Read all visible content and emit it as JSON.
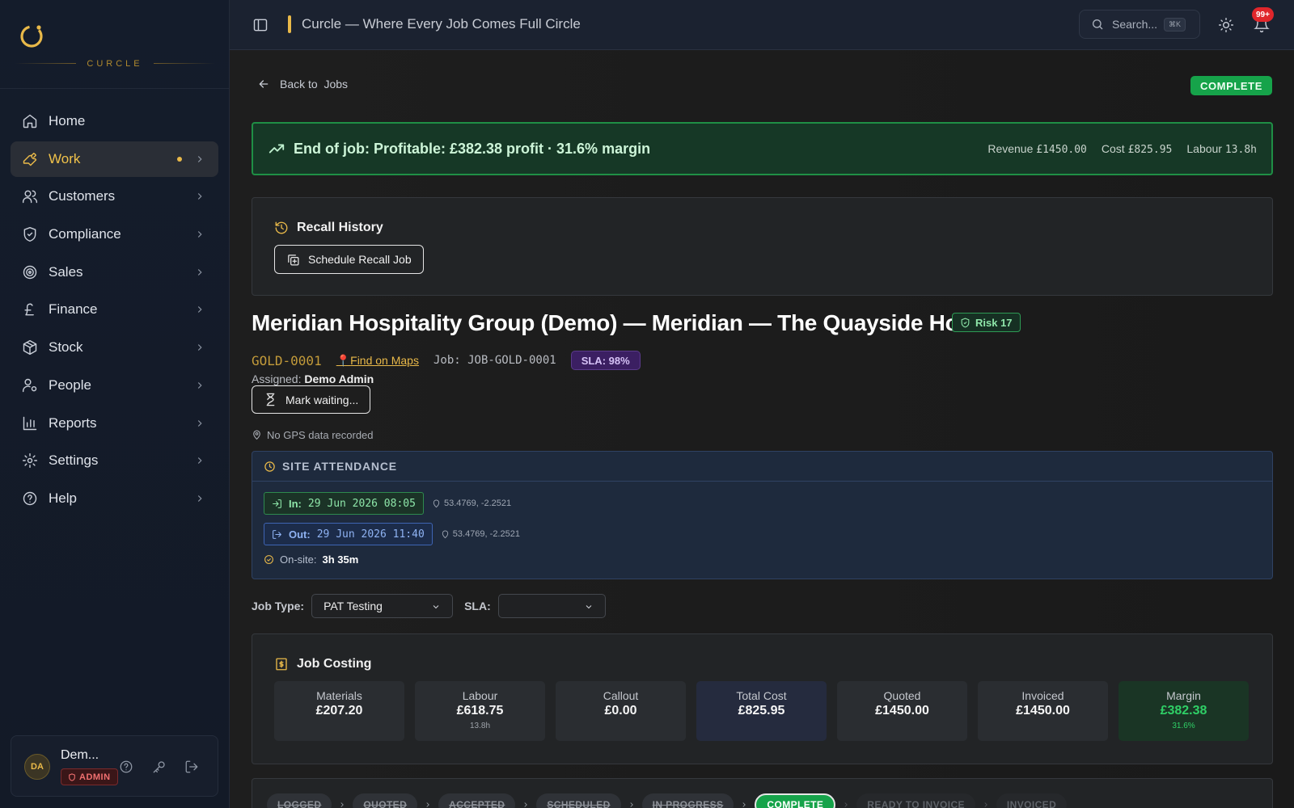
{
  "brand": {
    "name": "CURCLE"
  },
  "topbar": {
    "title": "Curcle — Where Every Job Comes Full Circle",
    "search_placeholder": "Search...",
    "search_shortcut": "⌘K",
    "notifications": "99+"
  },
  "sidebar": {
    "items": [
      {
        "label": "Home",
        "icon": "home-icon"
      },
      {
        "label": "Work",
        "icon": "wrench-icon",
        "active": true
      },
      {
        "label": "Customers",
        "icon": "users-icon"
      },
      {
        "label": "Compliance",
        "icon": "shield-icon"
      },
      {
        "label": "Sales",
        "icon": "target-icon"
      },
      {
        "label": "Finance",
        "icon": "pound-icon"
      },
      {
        "label": "Stock",
        "icon": "box-icon"
      },
      {
        "label": "People",
        "icon": "user-cog-icon"
      },
      {
        "label": "Reports",
        "icon": "bar-chart-icon"
      },
      {
        "label": "Settings",
        "icon": "gear-icon"
      },
      {
        "label": "Help",
        "icon": "help-icon"
      }
    ]
  },
  "user": {
    "initials": "DA",
    "name": "Dem...",
    "role": "ADMIN"
  },
  "page": {
    "back_prefix": "Back to",
    "back_target": "Jobs",
    "status": "COMPLETE"
  },
  "profit": {
    "summary": "End of job: Profitable: £382.38 profit · 31.6% margin",
    "revenue_label": "Revenue",
    "revenue_value": "£1450.00",
    "cost_label": "Cost",
    "cost_value": "£825.95",
    "labour_label": "Labour",
    "labour_value": "13.8h"
  },
  "recall": {
    "title": "Recall History",
    "button": "Schedule Recall Job"
  },
  "job": {
    "title": "Meridian Hospitality Group (Demo) — Meridian — The Quayside Hotel",
    "risk": "Risk 17",
    "ref": "GOLD-0001",
    "maps_link": "Find on Maps",
    "job_number": "Job: JOB-GOLD-0001",
    "sla_badge": "SLA: 98%",
    "assigned_label": "Assigned:",
    "assigned_name": "Demo Admin",
    "mark_waiting": "Mark waiting...",
    "gps": "No GPS data recorded"
  },
  "attendance": {
    "title": "SITE ATTENDANCE",
    "in_label": "In:",
    "in_time": "29 Jun 2026 08:05",
    "in_coord": "53.4769, -2.2521",
    "out_label": "Out:",
    "out_time": "29 Jun 2026 11:40",
    "out_coord": "53.4769, -2.2521",
    "onsite_label": "On-site:",
    "onsite_value": "3h 35m"
  },
  "selectors": {
    "job_type_label": "Job Type:",
    "job_type_value": "PAT Testing",
    "sla_label": "SLA:",
    "sla_value": ""
  },
  "costing": {
    "title": "Job Costing",
    "cards": [
      {
        "label": "Materials",
        "value": "£207.20",
        "sub": ""
      },
      {
        "label": "Labour",
        "value": "£618.75",
        "sub": "13.8h"
      },
      {
        "label": "Callout",
        "value": "£0.00",
        "sub": ""
      },
      {
        "label": "Total Cost",
        "value": "£825.95",
        "sub": ""
      },
      {
        "label": "Quoted",
        "value": "£1450.00",
        "sub": ""
      },
      {
        "label": "Invoiced",
        "value": "£1450.00",
        "sub": ""
      },
      {
        "label": "Margin",
        "value": "£382.38",
        "sub": "31.6%"
      }
    ]
  },
  "pipeline": {
    "steps": [
      "LOGGED",
      "QUOTED",
      "ACCEPTED",
      "SCHEDULED",
      "IN PROGRESS",
      "COMPLETE",
      "READY TO INVOICE",
      "INVOICED"
    ],
    "current": "COMPLETE"
  }
}
